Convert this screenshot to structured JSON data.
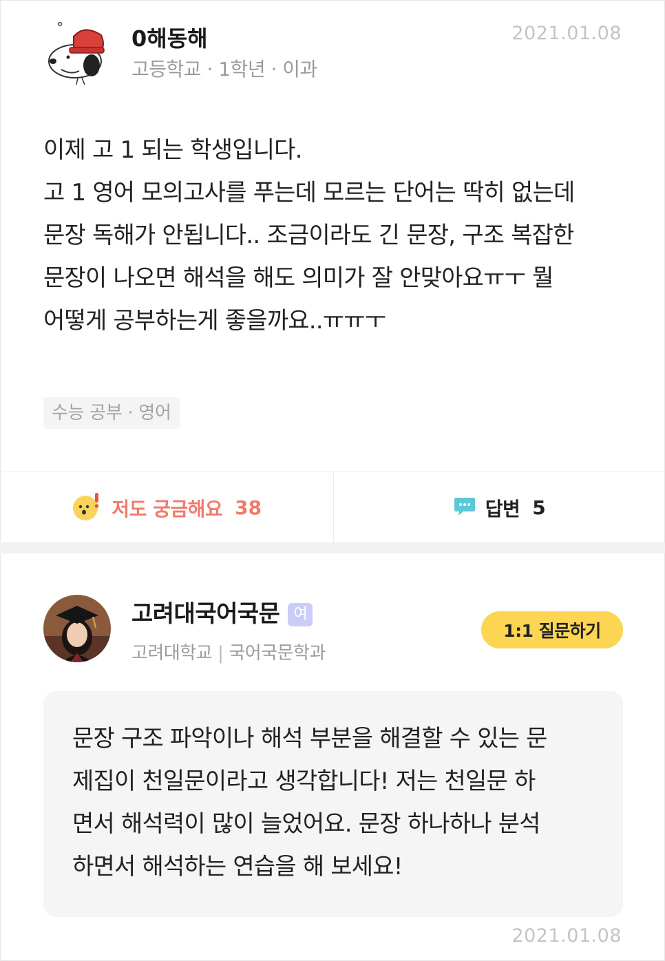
{
  "question": {
    "author_name": "0해동해",
    "author_meta": "고등학교 · 1학년 · 이과",
    "date": "2021.01.08",
    "body_lines": [
      "이제 고 1 되는 학생입니다.",
      "고 1 영어 모의고사를 푸는데 모르는 단어는 딱히 없는데",
      "문장 독해가 안됩니다.. 조금이라도 긴 문장, 구조 복잡한",
      "문장이 나오면 해석을 해도 의미가 잘 안맞아요ㅠㅜ 뭘",
      "어떻게 공부하는게 좋을까요..ㅠㅠㅜ"
    ],
    "tag": "수능 공부 · 영어"
  },
  "actions": {
    "curious_label": "저도 궁금해요",
    "curious_count": "38",
    "answer_label": "답변",
    "answer_count": "5"
  },
  "answer": {
    "author_name": "고려대국어국문",
    "gender_badge": "여",
    "school": "고려대학교",
    "separator": "|",
    "major": "국어국문학과",
    "ask_button_label": "1:1 질문하기",
    "body_lines": [
      "문장 구조 파악이나 해석 부분을 해결할 수 있는 문",
      "제집이 천일문이라고 생각합니다! 저는 천일문 하",
      "면서 해석력이 많이 늘었어요. 문장 하나하나 분석",
      "하면서 해석하는 연습을 해 보세요!"
    ],
    "date": "2021.01.08"
  },
  "icons": {
    "question_avatar": "snoopy-avatar",
    "answer_avatar": "graduation-photo-avatar",
    "curious_icon": "surprised-face-icon",
    "answer_icon": "speech-bubble-icon"
  },
  "colors": {
    "curious_accent": "#f07a6c",
    "ask_button": "#fcd653",
    "answer_icon": "#5bc8d8",
    "gender_badge": "#c9cdf7"
  }
}
